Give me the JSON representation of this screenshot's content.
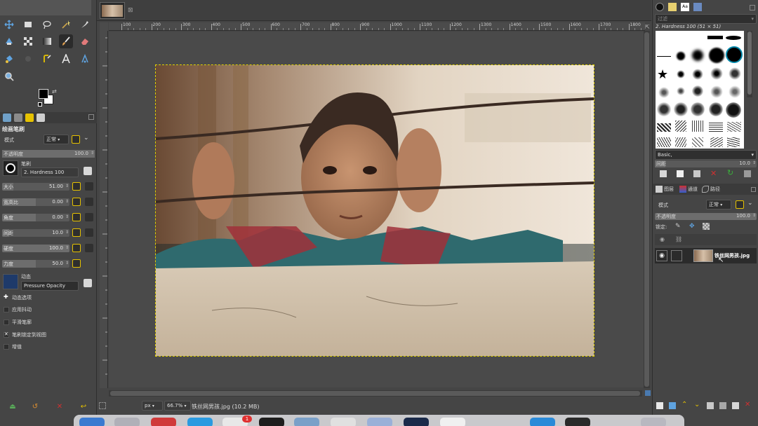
{
  "toolbox": {
    "tools": [
      {
        "name": "move-tool-icon"
      },
      {
        "name": "rect-select-tool-icon"
      },
      {
        "name": "lasso-tool-icon"
      },
      {
        "name": "fuzzy-select-tool-icon"
      },
      {
        "name": "paths-tool-icon"
      },
      {
        "name": "transform-tool-icon"
      },
      {
        "name": "warp-tool-icon"
      },
      {
        "name": "gradient-tool-icon"
      },
      {
        "name": "paintbrush-tool-icon"
      },
      {
        "name": "eraser-tool-icon"
      },
      {
        "name": "bucket-fill-tool-icon"
      },
      {
        "name": "smudge-tool-icon"
      },
      {
        "name": "color-picker-tool-icon"
      },
      {
        "name": "text-tool-icon"
      },
      {
        "name": "dodge-tool-icon"
      },
      {
        "name": "zoom-tool-icon"
      }
    ],
    "fg_color": "#000000",
    "bg_color": "#ffffff"
  },
  "tool_options": {
    "title": "绘画笔刷",
    "mode_label": "模式",
    "mode_value": "正常",
    "opacity_label": "不透明度",
    "opacity_value": "100.0",
    "brush_label": "笔刷",
    "brush_value": "2. Hardness 100",
    "sliders": [
      {
        "label": "大小",
        "value": "51.00",
        "fill": 0.17
      },
      {
        "label": "宽高比",
        "value": "0.00",
        "fill": 0.5
      },
      {
        "label": "角度",
        "value": "0.00",
        "fill": 0.5
      },
      {
        "label": "间距",
        "value": "10.0",
        "fill": 0.1
      },
      {
        "label": "硬度",
        "value": "100.0",
        "fill": 1.0
      },
      {
        "label": "力度",
        "value": "50.0",
        "fill": 0.5
      }
    ],
    "dynamics_label": "动态",
    "dynamics_value": "Pressure Opacity",
    "checks": [
      {
        "label": "动态选项",
        "checked": false,
        "expander": true
      },
      {
        "label": "应用抖动",
        "checked": false
      },
      {
        "label": "平滑笔廓",
        "checked": false
      },
      {
        "label": "笔刷锁定到视图",
        "checked": true
      },
      {
        "label": "增值",
        "checked": false
      }
    ]
  },
  "canvas": {
    "unit": "px",
    "zoom": "66.7%",
    "status_text": "铁丝网男孩.jpg (10.2 MB)",
    "ruler_ticks": [
      "100",
      "200",
      "300",
      "400",
      "500",
      "600",
      "700",
      "800",
      "900",
      "1000",
      "1100",
      "1200",
      "1300",
      "1400",
      "1500",
      "1600",
      "1700",
      "1800"
    ]
  },
  "brushes_panel": {
    "filter_placeholder": "过滤",
    "brush_name": "2. Hardness 100 (51 × 51)",
    "preset": "Basic,",
    "spacing_label": "间距",
    "spacing_value": "10.0"
  },
  "layers_panel": {
    "tabs": [
      "图层",
      "通道",
      "路径"
    ],
    "mode_label": "模式",
    "mode_value": "正常",
    "opacity_label": "不透明度",
    "opacity_value": "100.0",
    "lock_label": "锁定:",
    "layers": [
      {
        "name": "铁丝网男孩.jpg",
        "visible": true
      }
    ]
  },
  "colors": {
    "accent_yellow": "#e6c200",
    "selection_dash": "#e2d100",
    "red_icon": "#d03030",
    "green_icon": "#3ab03a"
  }
}
